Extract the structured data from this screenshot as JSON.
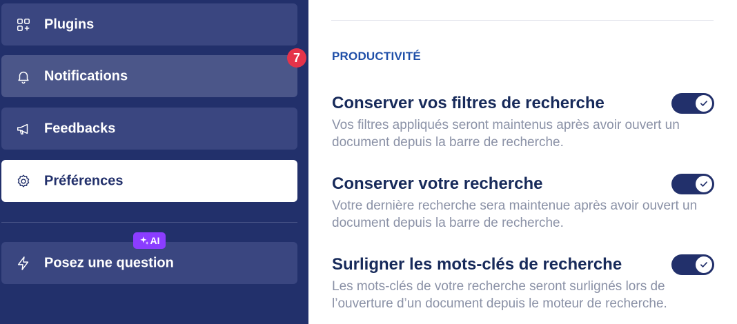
{
  "sidebar": {
    "items": [
      {
        "label": "Plugins",
        "icon": "plugins-icon"
      },
      {
        "label": "Notifications",
        "icon": "bell-icon",
        "badge": "7"
      },
      {
        "label": "Feedbacks",
        "icon": "megaphone-icon"
      },
      {
        "label": "Préférences",
        "icon": "gear-icon",
        "active": true
      },
      {
        "label": "Posez une question",
        "icon": "lightning-icon",
        "tag": "AI"
      }
    ]
  },
  "main": {
    "section_title": "PRODUCTIVITÉ",
    "preferences": [
      {
        "title": "Conserver vos filtres de recherche",
        "description": "Vos filtres appliqués seront maintenus après avoir ouvert un document depuis la barre de recherche.",
        "enabled": true
      },
      {
        "title": "Conserver votre recherche",
        "description": "Votre dernière recherche sera maintenue après avoir ouvert un document depuis la barre de recherche.",
        "enabled": true
      },
      {
        "title": "Surligner les mots-clés de recherche",
        "description": "Les mots-clés de votre recherche seront surlignés lors de l’ouverture d’un document depuis le moteur de recherche.",
        "enabled": true
      }
    ]
  },
  "colors": {
    "sidebar_bg": "#22306b",
    "item_bg": "#3a4680",
    "badge_red": "#e5334a",
    "ai_purple": "#8b3dff",
    "section_blue": "#1f4fa8"
  }
}
